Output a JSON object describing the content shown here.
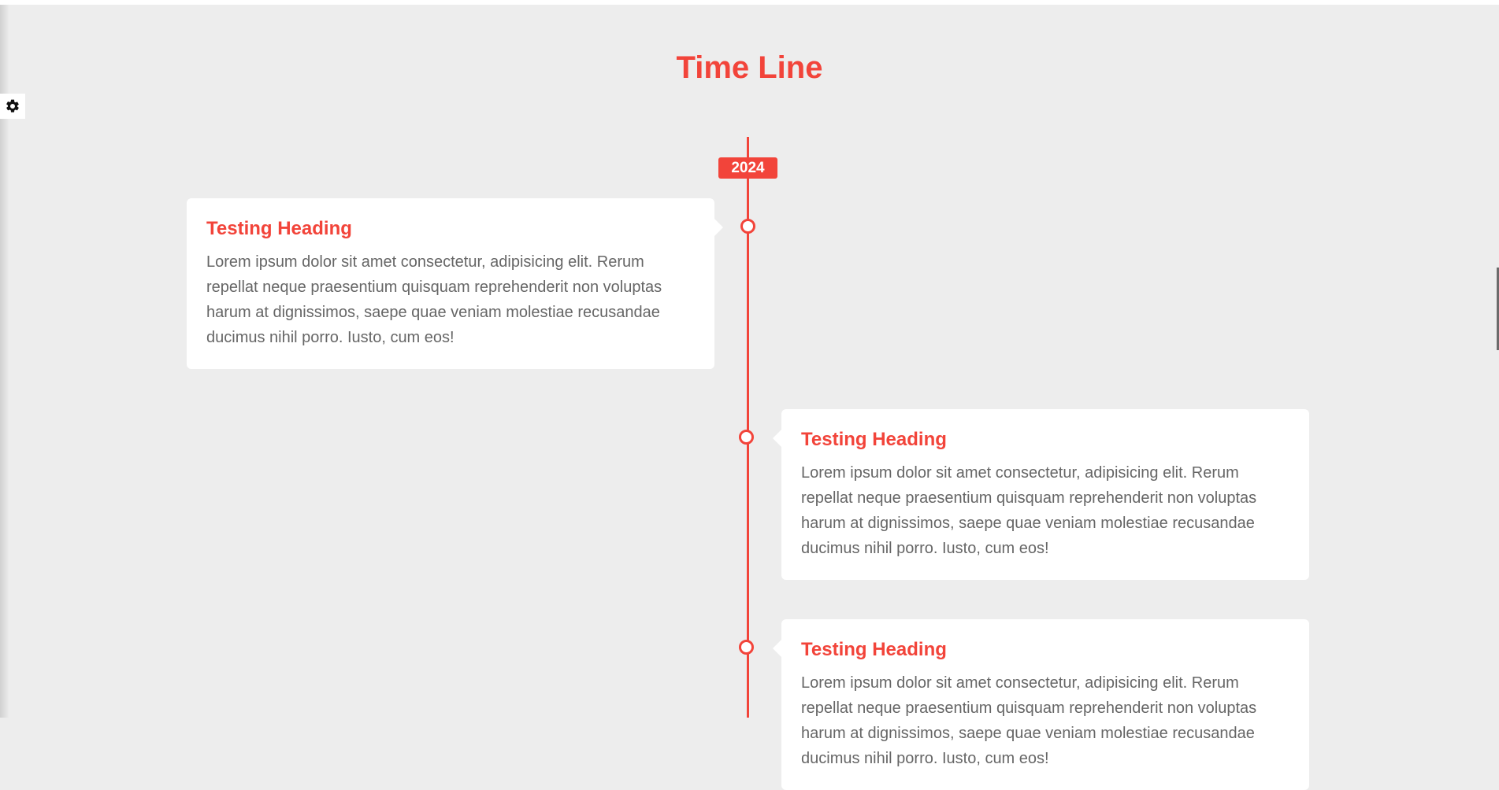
{
  "page": {
    "title": "Time Line"
  },
  "settings": {
    "icon": "gear-icon"
  },
  "timeline": {
    "year": "2024",
    "items": [
      {
        "side": "left",
        "heading": "Testing Heading",
        "text": "Lorem ipsum dolor sit amet consectetur, adipisicing elit. Rerum repellat neque praesentium quisquam reprehenderit non voluptas harum at dignissimos, saepe quae veniam molestiae recusandae ducimus nihil porro. Iusto, cum eos!"
      },
      {
        "side": "right",
        "heading": "Testing Heading",
        "text": "Lorem ipsum dolor sit amet consectetur, adipisicing elit. Rerum repellat neque praesentium quisquam reprehenderit non voluptas harum at dignissimos, saepe quae veniam molestiae recusandae ducimus nihil porro. Iusto, cum eos!"
      },
      {
        "side": "right",
        "heading": "Testing Heading",
        "text": "Lorem ipsum dolor sit amet consectetur, adipisicing elit. Rerum repellat neque praesentium quisquam reprehenderit non voluptas harum at dignissimos, saepe quae veniam molestiae recusandae ducimus nihil porro. Iusto, cum eos!"
      }
    ]
  },
  "colors": {
    "accent": "#f2443a",
    "background": "#ededed",
    "card": "#ffffff",
    "text": "#666666"
  }
}
